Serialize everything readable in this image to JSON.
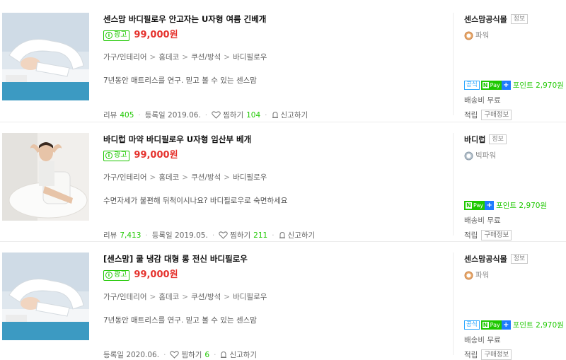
{
  "products": [
    {
      "title": "센스맘 바디필로우 안고자는 U자형 여름 긴베개",
      "ad_label": "광고",
      "price": "99,000원",
      "category": [
        "가구/인테리어",
        "홈데코",
        "쿠션/방석",
        "바디필로우"
      ],
      "description": "7년동안 매트리스를 연구. 믿고 볼 수 있는 센스맘",
      "review_label": "리뷰",
      "review_count": "405",
      "registered": "등록일 2019.06.",
      "wish_label": "찜하기",
      "wish_count": "104",
      "report_label": "신고하기",
      "seller": "센스맘공식몰",
      "seller_info": "정보",
      "grade": "파워",
      "grade_color": "#c9844a",
      "official_badge": "공식",
      "npay": "Pay",
      "plus": "+",
      "points": "포인트 2,970원",
      "shipping": "배송비 무료",
      "earn_label": "적립",
      "buy_info": "구매정보"
    },
    {
      "title": "바디럽 마약 바디필로우 U자형 임산부 베개",
      "ad_label": "광고",
      "price": "99,000원",
      "category": [
        "가구/인테리어",
        "홈데코",
        "쿠션/방석",
        "바디필로우"
      ],
      "description": "수면자세가 불편해 뒤척이시나요? 바디필로우로 숙면하세요",
      "review_label": "리뷰",
      "review_count": "7,413",
      "registered": "등록일 2019.05.",
      "wish_label": "찜하기",
      "wish_count": "211",
      "report_label": "신고하기",
      "seller": "바디럽",
      "seller_info": "정보",
      "grade": "빅파워",
      "grade_color": "#8a9aa8",
      "npay": "Pay",
      "plus": "+",
      "points": "포인트 2,970원",
      "shipping": "배송비 무료",
      "earn_label": "적립",
      "buy_info": "구매정보"
    },
    {
      "title": "[센스맘] 쿨 냉감 대형 롱 전신 바디필로우",
      "ad_label": "광고",
      "price": "99,000원",
      "category": [
        "가구/인테리어",
        "홈데코",
        "쿠션/방석",
        "바디필로우"
      ],
      "description": "7년동안 매트리스를 연구. 믿고 볼 수 있는 센스맘",
      "registered": "등록일 2020.06.",
      "wish_label": "찜하기",
      "wish_count": "6",
      "report_label": "신고하기",
      "seller": "센스맘공식몰",
      "seller_info": "정보",
      "grade": "파워",
      "grade_color": "#c9844a",
      "official_badge": "공식",
      "npay": "Pay",
      "plus": "+",
      "points": "포인트 2,970원",
      "shipping": "배송비 무료",
      "earn_label": "적립",
      "buy_info": "구매정보"
    }
  ],
  "colors": {
    "accent_green": "#1ec800",
    "price_red": "#e5322d",
    "official_blue": "#2aa7ff",
    "plus_blue": "#1e7cff"
  }
}
